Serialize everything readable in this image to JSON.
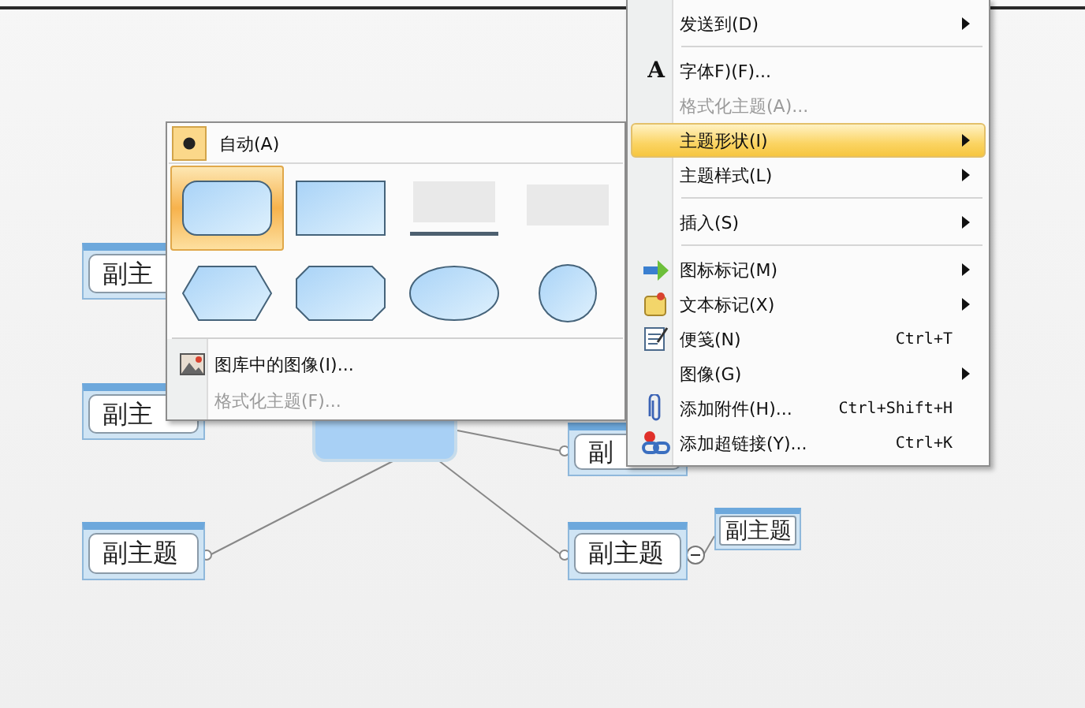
{
  "canvas": {
    "subtopics": [
      {
        "label": "副主",
        "kind": "normal"
      },
      {
        "label": "副主",
        "kind": "normal"
      },
      {
        "label": "副",
        "kind": "normal"
      },
      {
        "label": "副主题",
        "kind": "normal"
      },
      {
        "label": "副主题",
        "kind": "normal"
      },
      {
        "label": "副主题",
        "kind": "small"
      }
    ]
  },
  "menu": {
    "items": [
      {
        "kind": "item",
        "label": "发送到(D)",
        "submenu": true,
        "disabled": false,
        "selected": false
      },
      {
        "kind": "separator"
      },
      {
        "kind": "item",
        "icon_text": "A",
        "label": "字体F)(F)...",
        "submenu": false,
        "disabled": false,
        "selected": false
      },
      {
        "kind": "item",
        "label": "格式化主题(A)...",
        "submenu": false,
        "disabled": true,
        "selected": false
      },
      {
        "kind": "item",
        "label": "主题形状(I)",
        "submenu": true,
        "disabled": false,
        "selected": true
      },
      {
        "kind": "item",
        "label": "主题样式(L)",
        "submenu": true,
        "disabled": false,
        "selected": false
      },
      {
        "kind": "separator"
      },
      {
        "kind": "item",
        "label": "插入(S)",
        "submenu": true,
        "disabled": false,
        "selected": false
      },
      {
        "kind": "separator"
      },
      {
        "kind": "item",
        "label": "图标标记(M)",
        "submenu": true,
        "disabled": false,
        "selected": false
      },
      {
        "kind": "item",
        "label": "文本标记(X)",
        "submenu": true,
        "disabled": false,
        "selected": false
      },
      {
        "kind": "item",
        "label": "便笺(N)",
        "shortcut": "Ctrl+T",
        "submenu": false,
        "disabled": false,
        "selected": false
      },
      {
        "kind": "item",
        "label": "图像(G)",
        "submenu": true,
        "disabled": false,
        "selected": false
      },
      {
        "kind": "item",
        "label": "添加附件(H)...",
        "shortcut": "Ctrl+Shift+H",
        "submenu": false,
        "disabled": false,
        "selected": false
      },
      {
        "kind": "item",
        "label": "添加超链接(Y)...",
        "shortcut": "Ctrl+K",
        "submenu": false,
        "disabled": false,
        "selected": false
      }
    ]
  },
  "shape_menu": {
    "auto": {
      "label": "自动(A)",
      "checked": true
    },
    "shapes": [
      {
        "kind": "rounded-rectangle",
        "selected": true
      },
      {
        "kind": "rectangle",
        "selected": false
      },
      {
        "kind": "underline",
        "selected": false
      },
      {
        "kind": "none",
        "selected": false
      },
      {
        "kind": "hexagon",
        "selected": false
      },
      {
        "kind": "octagon",
        "selected": false
      },
      {
        "kind": "ellipse",
        "selected": false
      },
      {
        "kind": "circle",
        "selected": false
      }
    ],
    "items": [
      {
        "label": "图库中的图像(I)...",
        "disabled": false,
        "selected": false
      },
      {
        "label": "格式化主题(F)...",
        "disabled": true,
        "selected": false
      }
    ]
  }
}
